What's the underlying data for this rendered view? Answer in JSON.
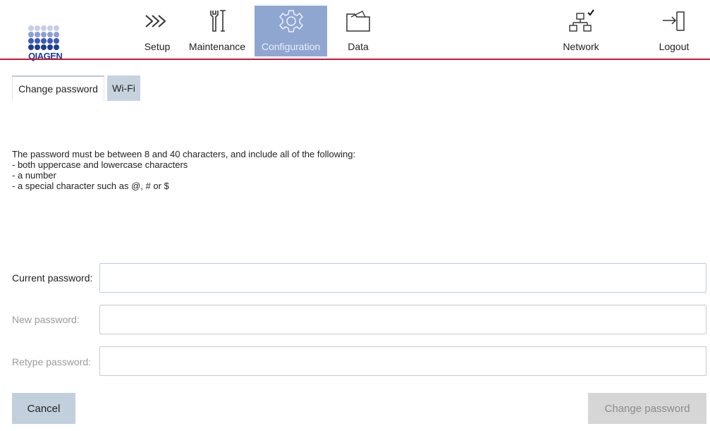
{
  "header": {
    "logo_text": "QIAGEN",
    "accent_color": "#c8173c",
    "active_color": "#8fa6d0",
    "nav": [
      {
        "label": "Setup",
        "icon": "setup-chevrons-icon"
      },
      {
        "label": "Maintenance",
        "icon": "wrench-icon"
      },
      {
        "label": "Configuration",
        "icon": "gear-icon",
        "active": true
      },
      {
        "label": "Data",
        "icon": "folder-icon"
      },
      {
        "label": "Network",
        "icon": "network-connected-icon"
      },
      {
        "label": "Logout",
        "icon": "logout-icon"
      }
    ]
  },
  "tabs": [
    {
      "label": "Change password",
      "active": true
    },
    {
      "label": "Wi-Fi",
      "active": false
    }
  ],
  "rules": {
    "intro": "The password must be between 8 and 40 characters, and include all of the following:",
    "items": [
      "- both uppercase and lowercase characters",
      "- a number",
      "- a special character such as @, # or $"
    ]
  },
  "form": {
    "current_label": "Current password:",
    "new_label": "New password:",
    "retype_label": "Retype password:",
    "current_value": "",
    "new_value": "",
    "retype_value": ""
  },
  "buttons": {
    "cancel": "Cancel",
    "change": "Change password"
  }
}
